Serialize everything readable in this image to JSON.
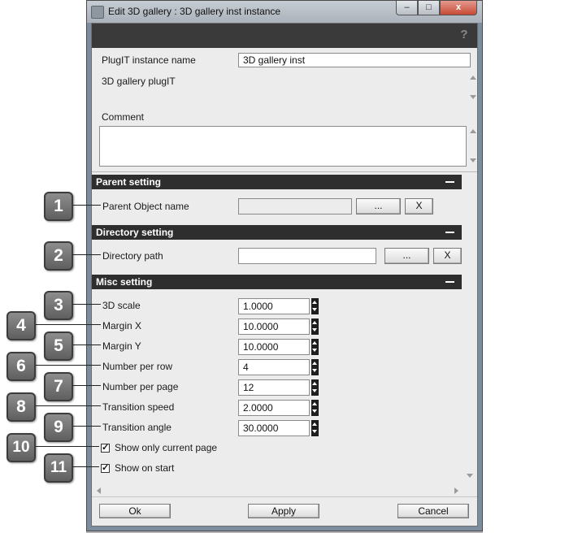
{
  "window": {
    "title": "Edit 3D gallery : 3D gallery inst instance",
    "minimize_glyph": "–",
    "maximize_glyph": "□",
    "close_glyph": "x",
    "help_glyph": "?"
  },
  "instance": {
    "name_label": "PlugIT instance name",
    "name_value": "3D gallery inst",
    "plugit_name": "3D gallery plugIT",
    "comment_label": "Comment",
    "comment_value": ""
  },
  "parent_setting": {
    "title": "Parent setting",
    "object_label": "Parent Object name",
    "object_value": "",
    "browse_label": "...",
    "clear_label": "X"
  },
  "directory_setting": {
    "title": "Directory setting",
    "path_label": "Directory path",
    "path_value": "",
    "browse_label": "...",
    "clear_label": "X"
  },
  "misc_setting": {
    "title": "Misc setting",
    "fields": [
      {
        "label": "3D scale",
        "value": "1.0000"
      },
      {
        "label": "Margin X",
        "value": "10.0000"
      },
      {
        "label": "Margin Y",
        "value": "10.0000"
      },
      {
        "label": "Number per row",
        "value": "4"
      },
      {
        "label": "Number per page",
        "value": "12"
      },
      {
        "label": "Transition speed",
        "value": "2.0000"
      },
      {
        "label": "Transition angle",
        "value": "30.0000"
      }
    ],
    "checkboxes": [
      {
        "label": "Show only current page",
        "checked": true,
        "mark": "✓"
      },
      {
        "label": "Show on start",
        "checked": true,
        "mark": "✓"
      }
    ]
  },
  "footer": {
    "ok_label": "Ok",
    "apply_label": "Apply",
    "cancel_label": "Cancel"
  },
  "callouts": [
    "1",
    "2",
    "3",
    "4",
    "5",
    "6",
    "7",
    "8",
    "9",
    "10",
    "11"
  ]
}
